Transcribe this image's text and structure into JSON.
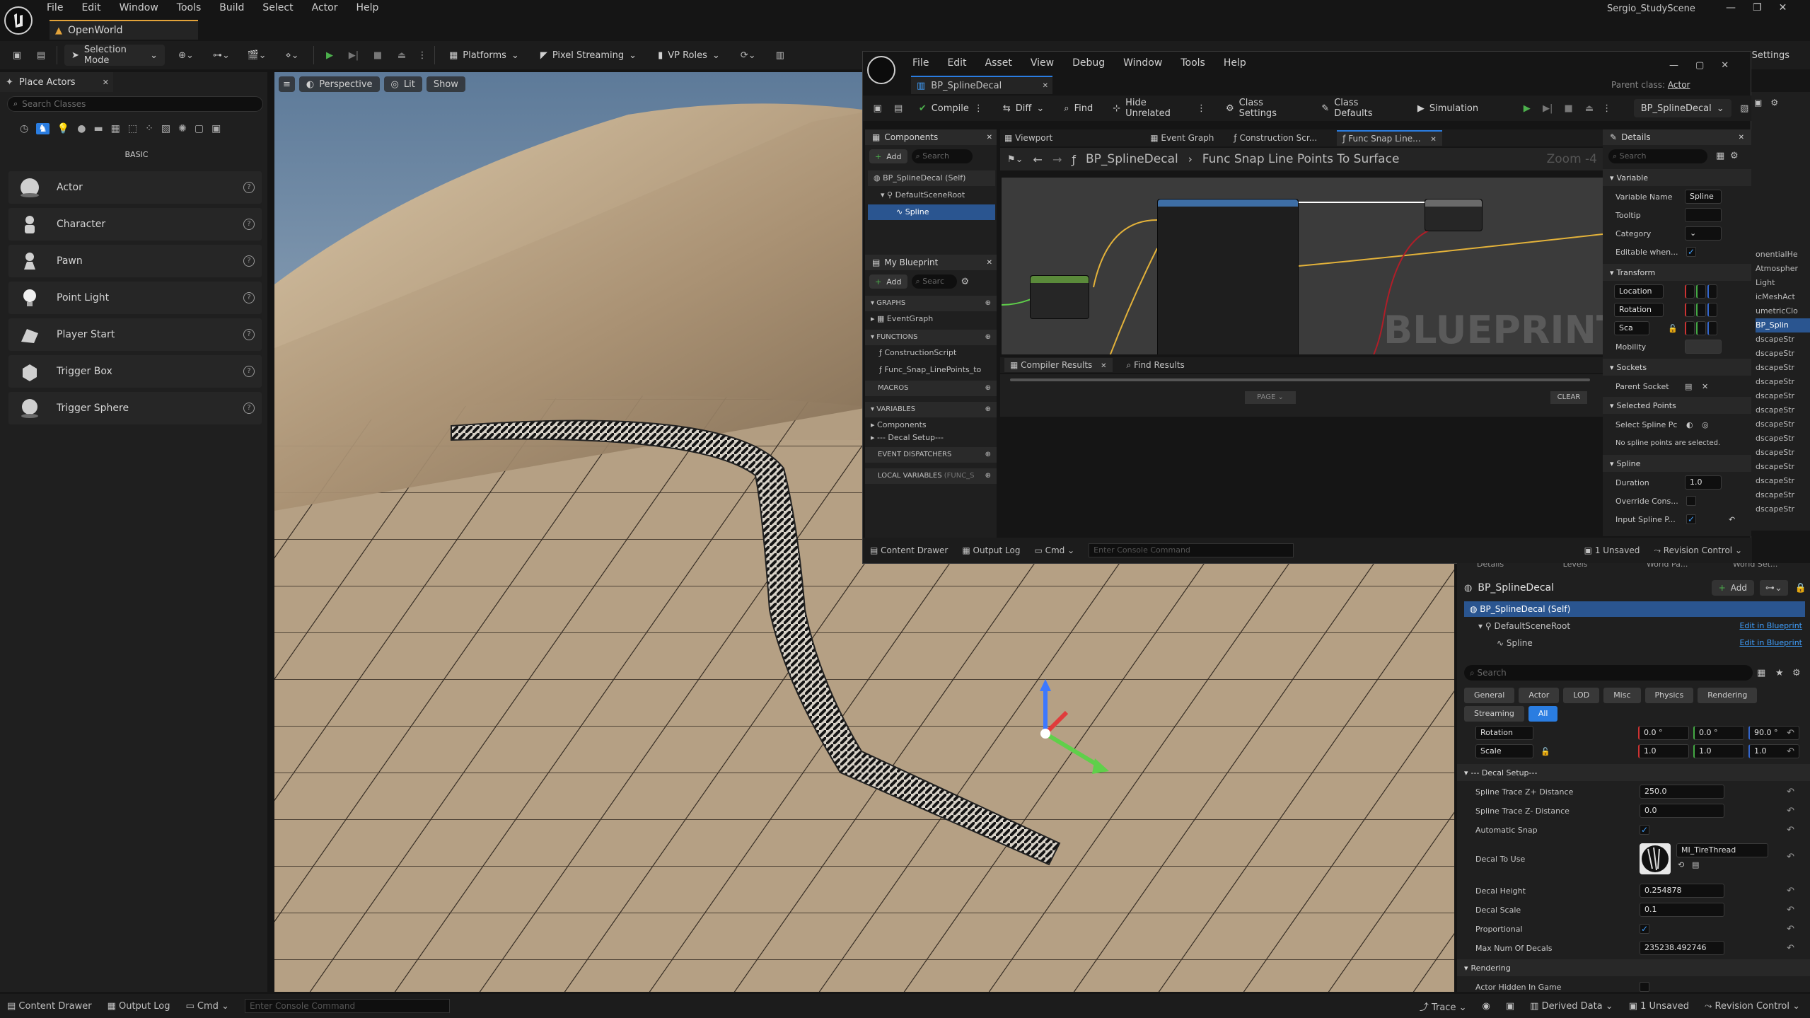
{
  "app": {
    "menu": [
      "File",
      "Edit",
      "Window",
      "Tools",
      "Build",
      "Select",
      "Actor",
      "Help"
    ],
    "project_name": "Sergio_StudyScene",
    "level_tab": "OpenWorld"
  },
  "main_toolbar": {
    "selection_mode": "Selection Mode",
    "platforms": "Platforms",
    "pixel_streaming": "Pixel Streaming",
    "vp_roles": "VP Roles",
    "settings": "Settings"
  },
  "place_actors": {
    "tab_title": "Place Actors",
    "search_placeholder": "Search Classes",
    "category": "BASIC",
    "items": [
      {
        "label": "Actor",
        "icon": "actor-sphere-icon"
      },
      {
        "label": "Character",
        "icon": "character-icon"
      },
      {
        "label": "Pawn",
        "icon": "pawn-icon"
      },
      {
        "label": "Point Light",
        "icon": "point-light-icon"
      },
      {
        "label": "Player Start",
        "icon": "player-start-icon"
      },
      {
        "label": "Trigger Box",
        "icon": "trigger-box-icon"
      },
      {
        "label": "Trigger Sphere",
        "icon": "trigger-sphere-icon"
      }
    ]
  },
  "viewport": {
    "perspective": "Perspective",
    "lit": "Lit",
    "show": "Show"
  },
  "bp_editor": {
    "menu": [
      "File",
      "Edit",
      "Asset",
      "View",
      "Debug",
      "Window",
      "Tools",
      "Help"
    ],
    "tab": "BP_SplineDecal",
    "parent_class_label": "Parent class:",
    "parent_class_value": "Actor",
    "toolbar": {
      "compile": "Compile",
      "diff": "Diff",
      "find": "Find",
      "hide_unrelated": "Hide Unrelated",
      "class_settings": "Class Settings",
      "class_defaults": "Class Defaults",
      "simulation": "Simulation",
      "debug_object": "BP_SplineDecal"
    },
    "components": {
      "title": "Components",
      "add": "Add",
      "search": "Search",
      "tree": [
        "BP_SplineDecal (Self)",
        "DefaultSceneRoot",
        "Spline"
      ]
    },
    "my_blueprint": {
      "title": "My Blueprint",
      "add": "Add",
      "search": "Searc",
      "graphs": "GRAPHS",
      "event_graph": "EventGraph",
      "functions": "FUNCTIONS",
      "fn1": "ConstructionScript",
      "fn2": "Func_Snap_LinePoints_to",
      "macros": "MACROS",
      "variables": "VARIABLES",
      "var1": "Components",
      "var2": "--- Decal Setup---",
      "event_dispatchers": "EVENT DISPATCHERS",
      "local_variables": "LOCAL VARIABLES",
      "local_variables_hint": "(FUNC_S"
    },
    "graph_tabs": [
      "Viewport",
      "Event Graph",
      "Construction Scr...",
      "Func Snap Line..."
    ],
    "breadcrumb": [
      "BP_SplineDecal",
      "Func Snap Line Points To Surface"
    ],
    "zoom": "Zoom -4",
    "watermark": "BLUEPRINT",
    "bottom_tabs": [
      "Compiler Results",
      "Find Results"
    ],
    "page_label": "PAGE",
    "clear_label": "CLEAR",
    "statusbar": {
      "content_drawer": "Content Drawer",
      "output_log": "Output Log",
      "cmd": "Cmd",
      "console_placeholder": "Enter Console Command",
      "unsaved": "1 Unsaved",
      "revision": "Revision Control"
    },
    "details": {
      "title": "Details",
      "search": "Search",
      "section_variable": "Variable",
      "variable_name_label": "Variable Name",
      "variable_name_value": "Spline",
      "tooltip_label": "Tooltip",
      "category_label": "Category",
      "editable_label": "Editable when...",
      "section_transform": "Transform",
      "location": "Location",
      "rotation": "Rotation",
      "scale": "Sca",
      "mobility": "Mobility",
      "section_sockets": "Sockets",
      "parent_socket": "Parent Socket",
      "section_selected_points": "Selected Points",
      "select_spline_points": "Select Spline Pc",
      "no_points": "No spline points are selected.",
      "section_spline": "Spline",
      "duration_label": "Duration",
      "duration_value": "1.0",
      "override_label": "Override Cons...",
      "input_spline_label": "Input Spline P..."
    }
  },
  "outliner_fragments": [
    "onentialHe",
    "Atmospher",
    "Light",
    "icMeshAct",
    "umetricClo",
    "BP_Splin",
    "dscapeStr",
    "dscapeStr",
    "dscapeStr",
    "dscapeStr",
    "dscapeStr",
    "dscapeStr",
    "dscapeStr",
    "dscapeStr",
    "dscapeStr",
    "dscapeStr",
    "dscapeStr",
    "dscapeStr",
    "dscapeStr"
  ],
  "level_details": {
    "tabs": [
      "Details",
      "Levels",
      "World Pa...",
      "World Set..."
    ],
    "title": "BP_SplineDecal",
    "add": "Add",
    "tree": [
      "BP_SplineDecal (Self)",
      "DefaultSceneRoot",
      "Spline"
    ],
    "edit_in_blueprint": "Edit in Blueprint",
    "search": "Search",
    "filters": [
      "General",
      "Actor",
      "LOD",
      "Misc",
      "Physics",
      "Rendering",
      "Streaming",
      "All"
    ],
    "rotation_label": "Rotation",
    "rotation_values": [
      "0.0 °",
      "0.0 °",
      "90.0 °"
    ],
    "scale_label": "Scale",
    "scale_values": [
      "1.0",
      "1.0",
      "1.0"
    ],
    "section_decal": "--- Decal Setup---",
    "props": [
      {
        "label": "Spline Trace Z+ Distance",
        "value": "250.0"
      },
      {
        "label": "Spline Trace Z- Distance",
        "value": "0.0"
      },
      {
        "label": "Automatic Snap",
        "value": "✓"
      },
      {
        "label": "Decal To Use",
        "value": "MI_TireThread"
      },
      {
        "label": "Decal Height",
        "value": "0.254878"
      },
      {
        "label": "Decal Scale",
        "value": "0.1"
      },
      {
        "label": "Proportional",
        "value": "✓"
      },
      {
        "label": "Max Num Of Decals",
        "value": "235238.492746"
      }
    ],
    "section_rendering": "Rendering",
    "actor_hidden": "Actor Hidden In Game"
  },
  "statusbar": {
    "content_drawer": "Content Drawer",
    "output_log": "Output Log",
    "cmd": "Cmd",
    "console_placeholder": "Enter Console Command",
    "trace": "Trace",
    "derived_data": "Derived Data",
    "unsaved": "1 Unsaved",
    "revision": "Revision Control"
  },
  "colors": {
    "accent_blue": "#2a7de1",
    "play_green": "#4cb04c",
    "panel_bg": "#1f1f1f"
  }
}
